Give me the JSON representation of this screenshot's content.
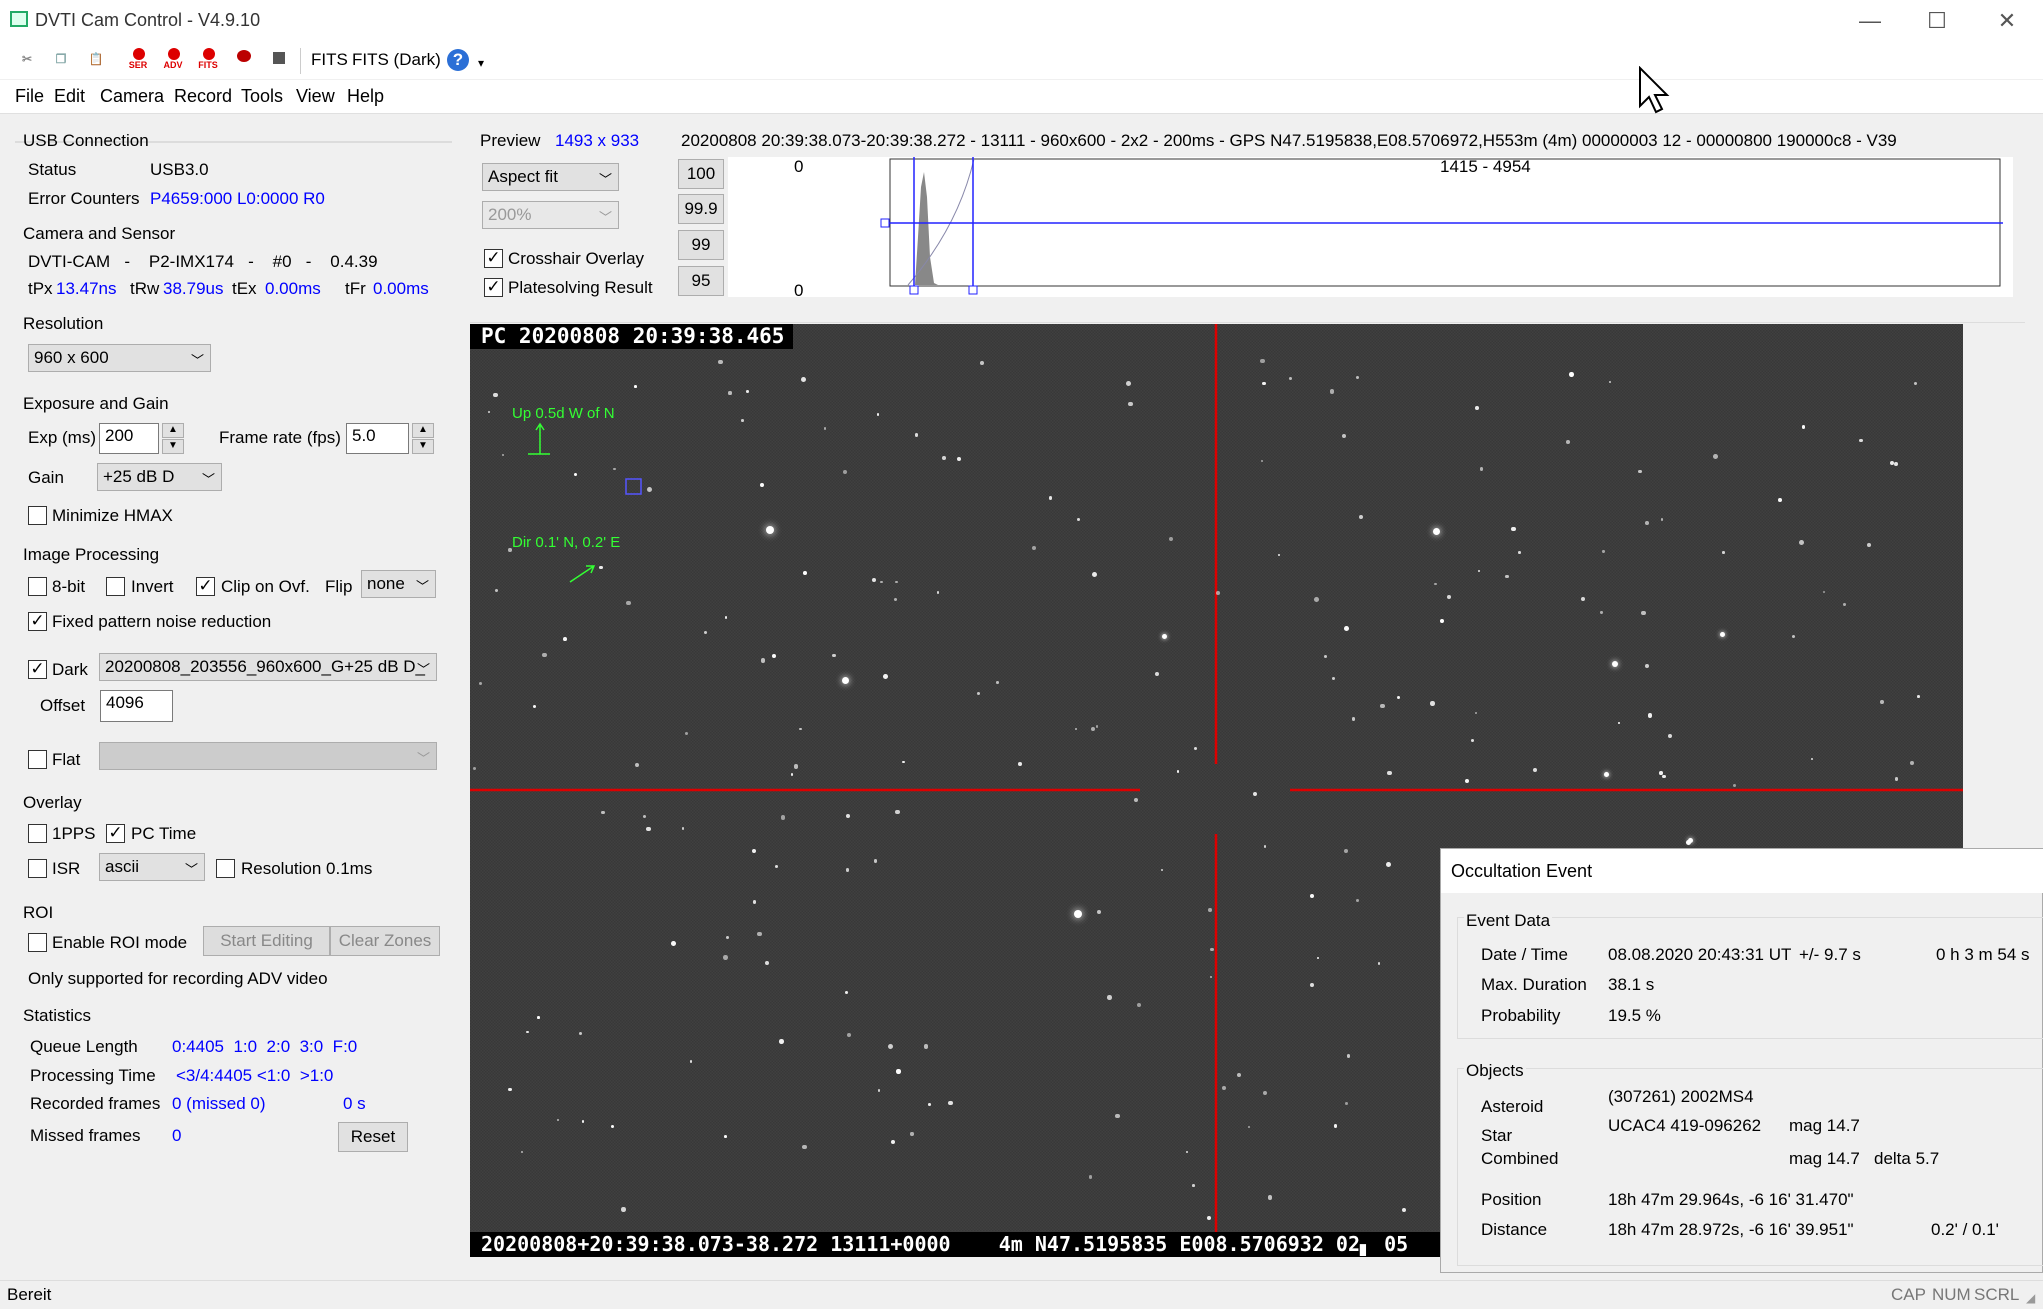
{
  "window": {
    "title": "DVTI Cam Control - V4.9.10",
    "minimize": "—",
    "maximize": "☐",
    "close": "✕"
  },
  "toolbar": {
    "items": [
      "cut-icon",
      "copy-icon",
      "paste-icon",
      "ser-icon",
      "adv-icon",
      "fits-icon",
      "record-icon",
      "stop-icon"
    ],
    "ser": "SER",
    "adv": "ADV",
    "fits_small": "FITS",
    "fits": "FITS",
    "fits_dark": "FITS (Dark)",
    "help": "?",
    "more": "▾"
  },
  "menu": [
    "File",
    "Edit",
    "Camera",
    "Record",
    "Tools",
    "View",
    "Help"
  ],
  "usb": {
    "title": "USB Connection",
    "status_label": "Status",
    "status_value": "USB3.0",
    "err_label": "Error Counters",
    "err_value": "P4659:000 L0:0000 R0"
  },
  "camera": {
    "title": "Camera and Sensor",
    "line": "DVTI-CAM   -    P2-IMX174   -    #0   -    0.4.39",
    "tpx_label": "tPx",
    "tpx": "13.47ns",
    "trw_label": "tRw",
    "trw": "38.79us",
    "tex_label": "tEx",
    "tex": "0.00ms",
    "tfr_label": "tFr",
    "tfr": "0.00ms"
  },
  "resolution": {
    "title": "Resolution",
    "value": "960 x 600"
  },
  "exposure": {
    "title": "Exposure and Gain",
    "exp_label": "Exp (ms)",
    "exp": "200",
    "fr_label": "Frame rate (fps)",
    "fr": "5.0",
    "gain_label": "Gain",
    "gain": "+25 dB D",
    "hmax": "Minimize HMAX"
  },
  "imgproc": {
    "title": "Image Processing",
    "bit8": "8-bit",
    "invert": "Invert",
    "clip": "Clip on Ovf.",
    "flip_label": "Flip",
    "flip": "none",
    "fpn": "Fixed pattern noise reduction",
    "dark": "Dark",
    "dark_file": "20200808_203556_960x600_G+25 dB D_",
    "offset_label": "Offset",
    "offset": "4096",
    "flat": "Flat"
  },
  "overlay": {
    "title": "Overlay",
    "pps": "1PPS",
    "pctime": "PC Time",
    "isr": "ISR",
    "isr_mode": "ascii",
    "res": "Resolution 0.1ms"
  },
  "roi": {
    "title": "ROI",
    "enable": "Enable ROI mode",
    "start": "Start Editing",
    "clear": "Clear Zones",
    "note": "Only supported for recording ADV video"
  },
  "stats": {
    "title": "Statistics",
    "ql_label": "Queue Length",
    "ql": "0:4405  1:0  2:0  3:0  F:0",
    "pt_label": "Processing Time",
    "pt": "<3/4:4405 <1:0  >1:0",
    "rf_label": "Recorded frames",
    "rf": "0 (missed 0)",
    "rf_time": "0 s",
    "mf_label": "Missed frames",
    "mf": "0",
    "reset": "Reset"
  },
  "preview": {
    "label": "Preview",
    "size": "1493 x 933",
    "info": "20200808 20:39:38.073-20:39:38.272 - 13111 - 960x600 - 2x2 - 200ms - GPS N47.5195838,E08.5706972,H553m (4m) 00000003 12 - 00000800 190000c8 - V39",
    "fit": "Aspect fit",
    "zoom": "200%",
    "crosshair": "Crosshair Overlay",
    "platesolve": "Platesolving Result",
    "p100": "100",
    "p999": "99.9",
    "p99": "99",
    "p95": "95",
    "hist_top": "0",
    "hist_bottom": "0",
    "hist_range": "1415 - 4954"
  },
  "image": {
    "ts_top": "PC 20200808 20:39:38.465",
    "up": "Up 0.5d W of N",
    "dir": "Dir 0.1' N, 0.2' E",
    "ts_bottom": "20200808+20:39:38.073-38.272 13111+0000    4m N47.5195835 E008.5706932 02▖ 05"
  },
  "event": {
    "title": "Occultation Event",
    "data_title": "Event Data",
    "dt_label": "Date / Time",
    "dt": "08.08.2020 20:43:31 UT",
    "dt_err": "+/- 9.7 s",
    "dt_rel": "0 h 3 m 54 s",
    "md_label": "Max. Duration",
    "md": "38.1 s",
    "pr_label": "Probability",
    "pr": "19.5 %",
    "obj_title": "Objects",
    "ast_label": "Asteroid",
    "ast": "(307261) 2002MS4",
    "star_label": "Star",
    "star": "UCAC4 419-096262",
    "star_mag": "mag 14.7",
    "comb_label": "Combined",
    "comb_mag": "mag 14.7",
    "comb_delta": "delta 5.7",
    "pos_label": "Position",
    "pos": "18h 47m 29.964s, -6 16' 31.470\"",
    "dist_label": "Distance",
    "dist": "18h 47m 28.972s, -6 16' 39.951\"",
    "dist_err": "0.2' / 0.1'"
  },
  "status": {
    "text": "Bereit",
    "cap": "CAP",
    "num": "NUM",
    "scrl": "SCRL"
  },
  "checks": {
    "mark": "✓"
  }
}
